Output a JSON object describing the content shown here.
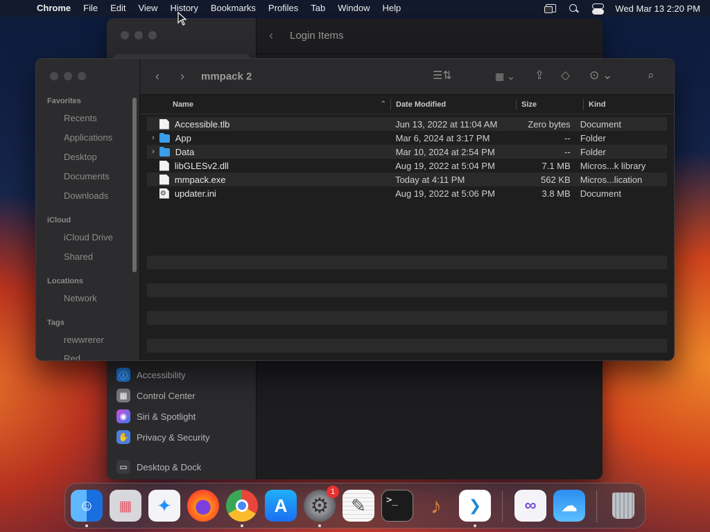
{
  "menubar": {
    "app": "Chrome",
    "items": [
      "File",
      "Edit",
      "View",
      "History",
      "Bookmarks",
      "Profiles",
      "Tab",
      "Window",
      "Help"
    ],
    "clock": "Wed Mar 13  2:20 PM"
  },
  "settings": {
    "title": "Login Items",
    "items": [
      {
        "label": "Accessibility",
        "color": "#1f7be0",
        "glyph": "ⓘ"
      },
      {
        "label": "Control Center",
        "color": "#7a7a7e",
        "glyph": "▦"
      },
      {
        "label": "Siri & Spotlight",
        "color": "#c04ad8",
        "glyph": "◉"
      },
      {
        "label": "Privacy & Security",
        "color": "#4a7fdc",
        "glyph": "✋"
      },
      {
        "label": "Desktop & Dock",
        "color": "#3a3a3e",
        "glyph": "▭"
      }
    ]
  },
  "finder": {
    "folder_title": "mmpack 2",
    "sidebar": {
      "favorites_title": "Favorites",
      "favorites": [
        "Recents",
        "Applications",
        "Desktop",
        "Documents",
        "Downloads"
      ],
      "icloud_title": "iCloud",
      "icloud": [
        "iCloud Drive",
        "Shared"
      ],
      "locations_title": "Locations",
      "locations": [
        "Network"
      ],
      "tags_title": "Tags",
      "tags": [
        "rewwrerer",
        "Red"
      ]
    },
    "columns": {
      "name": "Name",
      "date": "Date Modified",
      "size": "Size",
      "kind": "Kind"
    },
    "files": [
      {
        "name": "Accessible.tlb",
        "date": "Jun 13, 2022 at 11:04 AM",
        "size": "Zero bytes",
        "kind": "Document",
        "type": "doc",
        "expandable": false
      },
      {
        "name": "App",
        "date": "Mar 6, 2024 at 3:17 PM",
        "size": "--",
        "kind": "Folder",
        "type": "folder",
        "expandable": true
      },
      {
        "name": "Data",
        "date": "Mar 10, 2024 at 2:54 PM",
        "size": "--",
        "kind": "Folder",
        "type": "folder",
        "expandable": true
      },
      {
        "name": "libGLESv2.dll",
        "date": "Aug 19, 2022 at 5:04 PM",
        "size": "7.1 MB",
        "kind": "Micros...k library",
        "type": "doc",
        "expandable": false
      },
      {
        "name": "mmpack.exe",
        "date": "Today at 4:11 PM",
        "size": "562 KB",
        "kind": "Micros...lication",
        "type": "doc",
        "expandable": false
      },
      {
        "name": "updater.ini",
        "date": "Aug 19, 2022 at 5:06 PM",
        "size": "3.8 MB",
        "kind": "Document",
        "type": "cfg",
        "expandable": false
      }
    ]
  },
  "dock": {
    "apps": [
      {
        "id": "finder-icon",
        "color": "#2d8cf0",
        "glyph": "☺",
        "running": true
      },
      {
        "id": "launchpad-icon",
        "color": "#d9d9de",
        "glyph": "▦",
        "running": false
      },
      {
        "id": "safari-icon",
        "color": "#1e90ff",
        "glyph": "✦",
        "running": false
      },
      {
        "id": "firefox-icon",
        "color": "#ff7a1a",
        "glyph": "◉",
        "running": false
      },
      {
        "id": "chrome-icon",
        "color": "#e8e8e8",
        "glyph": "◎",
        "running": true
      },
      {
        "id": "app-store-icon",
        "color": "#1c8ef2",
        "glyph": "A",
        "running": false
      },
      {
        "id": "system-settings-icon",
        "color": "#8a8a8e",
        "glyph": "⚙",
        "running": true,
        "badge": "1"
      },
      {
        "id": "textedit-icon",
        "color": "#f3f3f3",
        "glyph": "✎",
        "running": false
      },
      {
        "id": "terminal-icon",
        "color": "#1b1b1b",
        "glyph": ">_",
        "running": false
      },
      {
        "id": "garageband-icon",
        "color": "#3a2a1e",
        "glyph": "♪",
        "running": false
      },
      {
        "id": "vscode-icon",
        "color": "#ffffff",
        "glyph": "❮❯",
        "running": true
      },
      {
        "id": "visual-studio-icon",
        "color": "#f2f2f7",
        "glyph": "∞",
        "running": false
      },
      {
        "id": "weather-icon",
        "color": "#3da9f5",
        "glyph": "☁",
        "running": false
      },
      {
        "id": "trash-icon",
        "color": "transparent",
        "glyph": "🗑",
        "running": false
      }
    ]
  }
}
